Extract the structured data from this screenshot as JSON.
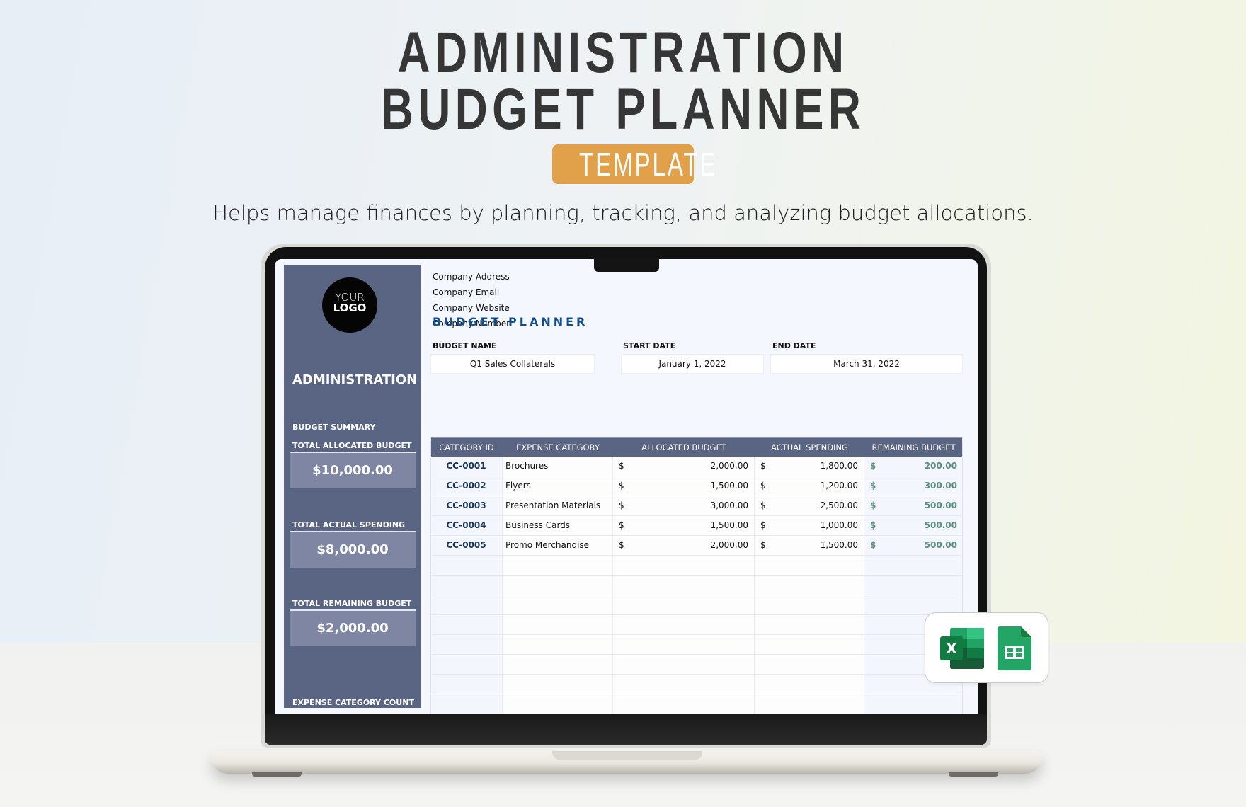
{
  "page": {
    "title_line1": "ADMINISTRATION",
    "title_line2": "BUDGET PLANNER",
    "badge": "TEMPLATE",
    "subtitle": "Helps manage finances by planning, tracking, and analyzing budget allocations."
  },
  "colors": {
    "badge": "#e1a04a",
    "sidebar": "#5a6583",
    "summary_box": "#7e86a3",
    "heading_blue": "#134e8f",
    "category_id": "#16335c",
    "remaining_green": "#5b8f7f"
  },
  "sidebar": {
    "logo_line1": "YOUR",
    "logo_line2": "LOGO",
    "department": "ADMINISTRATION",
    "summary_heading": "BUDGET SUMMARY",
    "items": [
      {
        "label": "TOTAL ALLOCATED BUDGET",
        "value": "$10,000.00"
      },
      {
        "label": "TOTAL ACTUAL SPENDING",
        "value": "$8,000.00"
      },
      {
        "label": "TOTAL REMAINING BUDGET",
        "value": "$2,000.00"
      }
    ],
    "count_label": "EXPENSE CATEGORY COUNT"
  },
  "company": {
    "address": "Company Address",
    "email": "Company Email",
    "website": "Company Website",
    "number": "Company Number"
  },
  "planner": {
    "title": "BUDGET PLANNER",
    "fields": [
      {
        "label": "BUDGET NAME",
        "value": "Q1 Sales Collaterals"
      },
      {
        "label": "START DATE",
        "value": "January 1, 2022"
      },
      {
        "label": "END DATE",
        "value": "March 31, 2022"
      }
    ]
  },
  "table": {
    "columns": [
      "CATEGORY ID",
      "EXPENSE CATEGORY",
      "ALLOCATED BUDGET",
      "ACTUAL SPENDING",
      "REMAINING BUDGET"
    ],
    "currency": "$",
    "rows": [
      {
        "id": "CC-0001",
        "category": "Brochures",
        "allocated": "2,000.00",
        "actual": "1,800.00",
        "remaining": "200.00"
      },
      {
        "id": "CC-0002",
        "category": "Flyers",
        "allocated": "1,500.00",
        "actual": "1,200.00",
        "remaining": "300.00"
      },
      {
        "id": "CC-0003",
        "category": "Presentation Materials",
        "allocated": "3,000.00",
        "actual": "2,500.00",
        "remaining": "500.00"
      },
      {
        "id": "CC-0004",
        "category": "Business Cards",
        "allocated": "1,500.00",
        "actual": "1,000.00",
        "remaining": "500.00"
      },
      {
        "id": "CC-0005",
        "category": "Promo Merchandise",
        "allocated": "2,000.00",
        "actual": "1,500.00",
        "remaining": "500.00"
      }
    ],
    "empty_rows": 8
  },
  "apps": {
    "icons": [
      "microsoft-excel-icon",
      "google-sheets-icon"
    ],
    "excel_letter": "X"
  }
}
